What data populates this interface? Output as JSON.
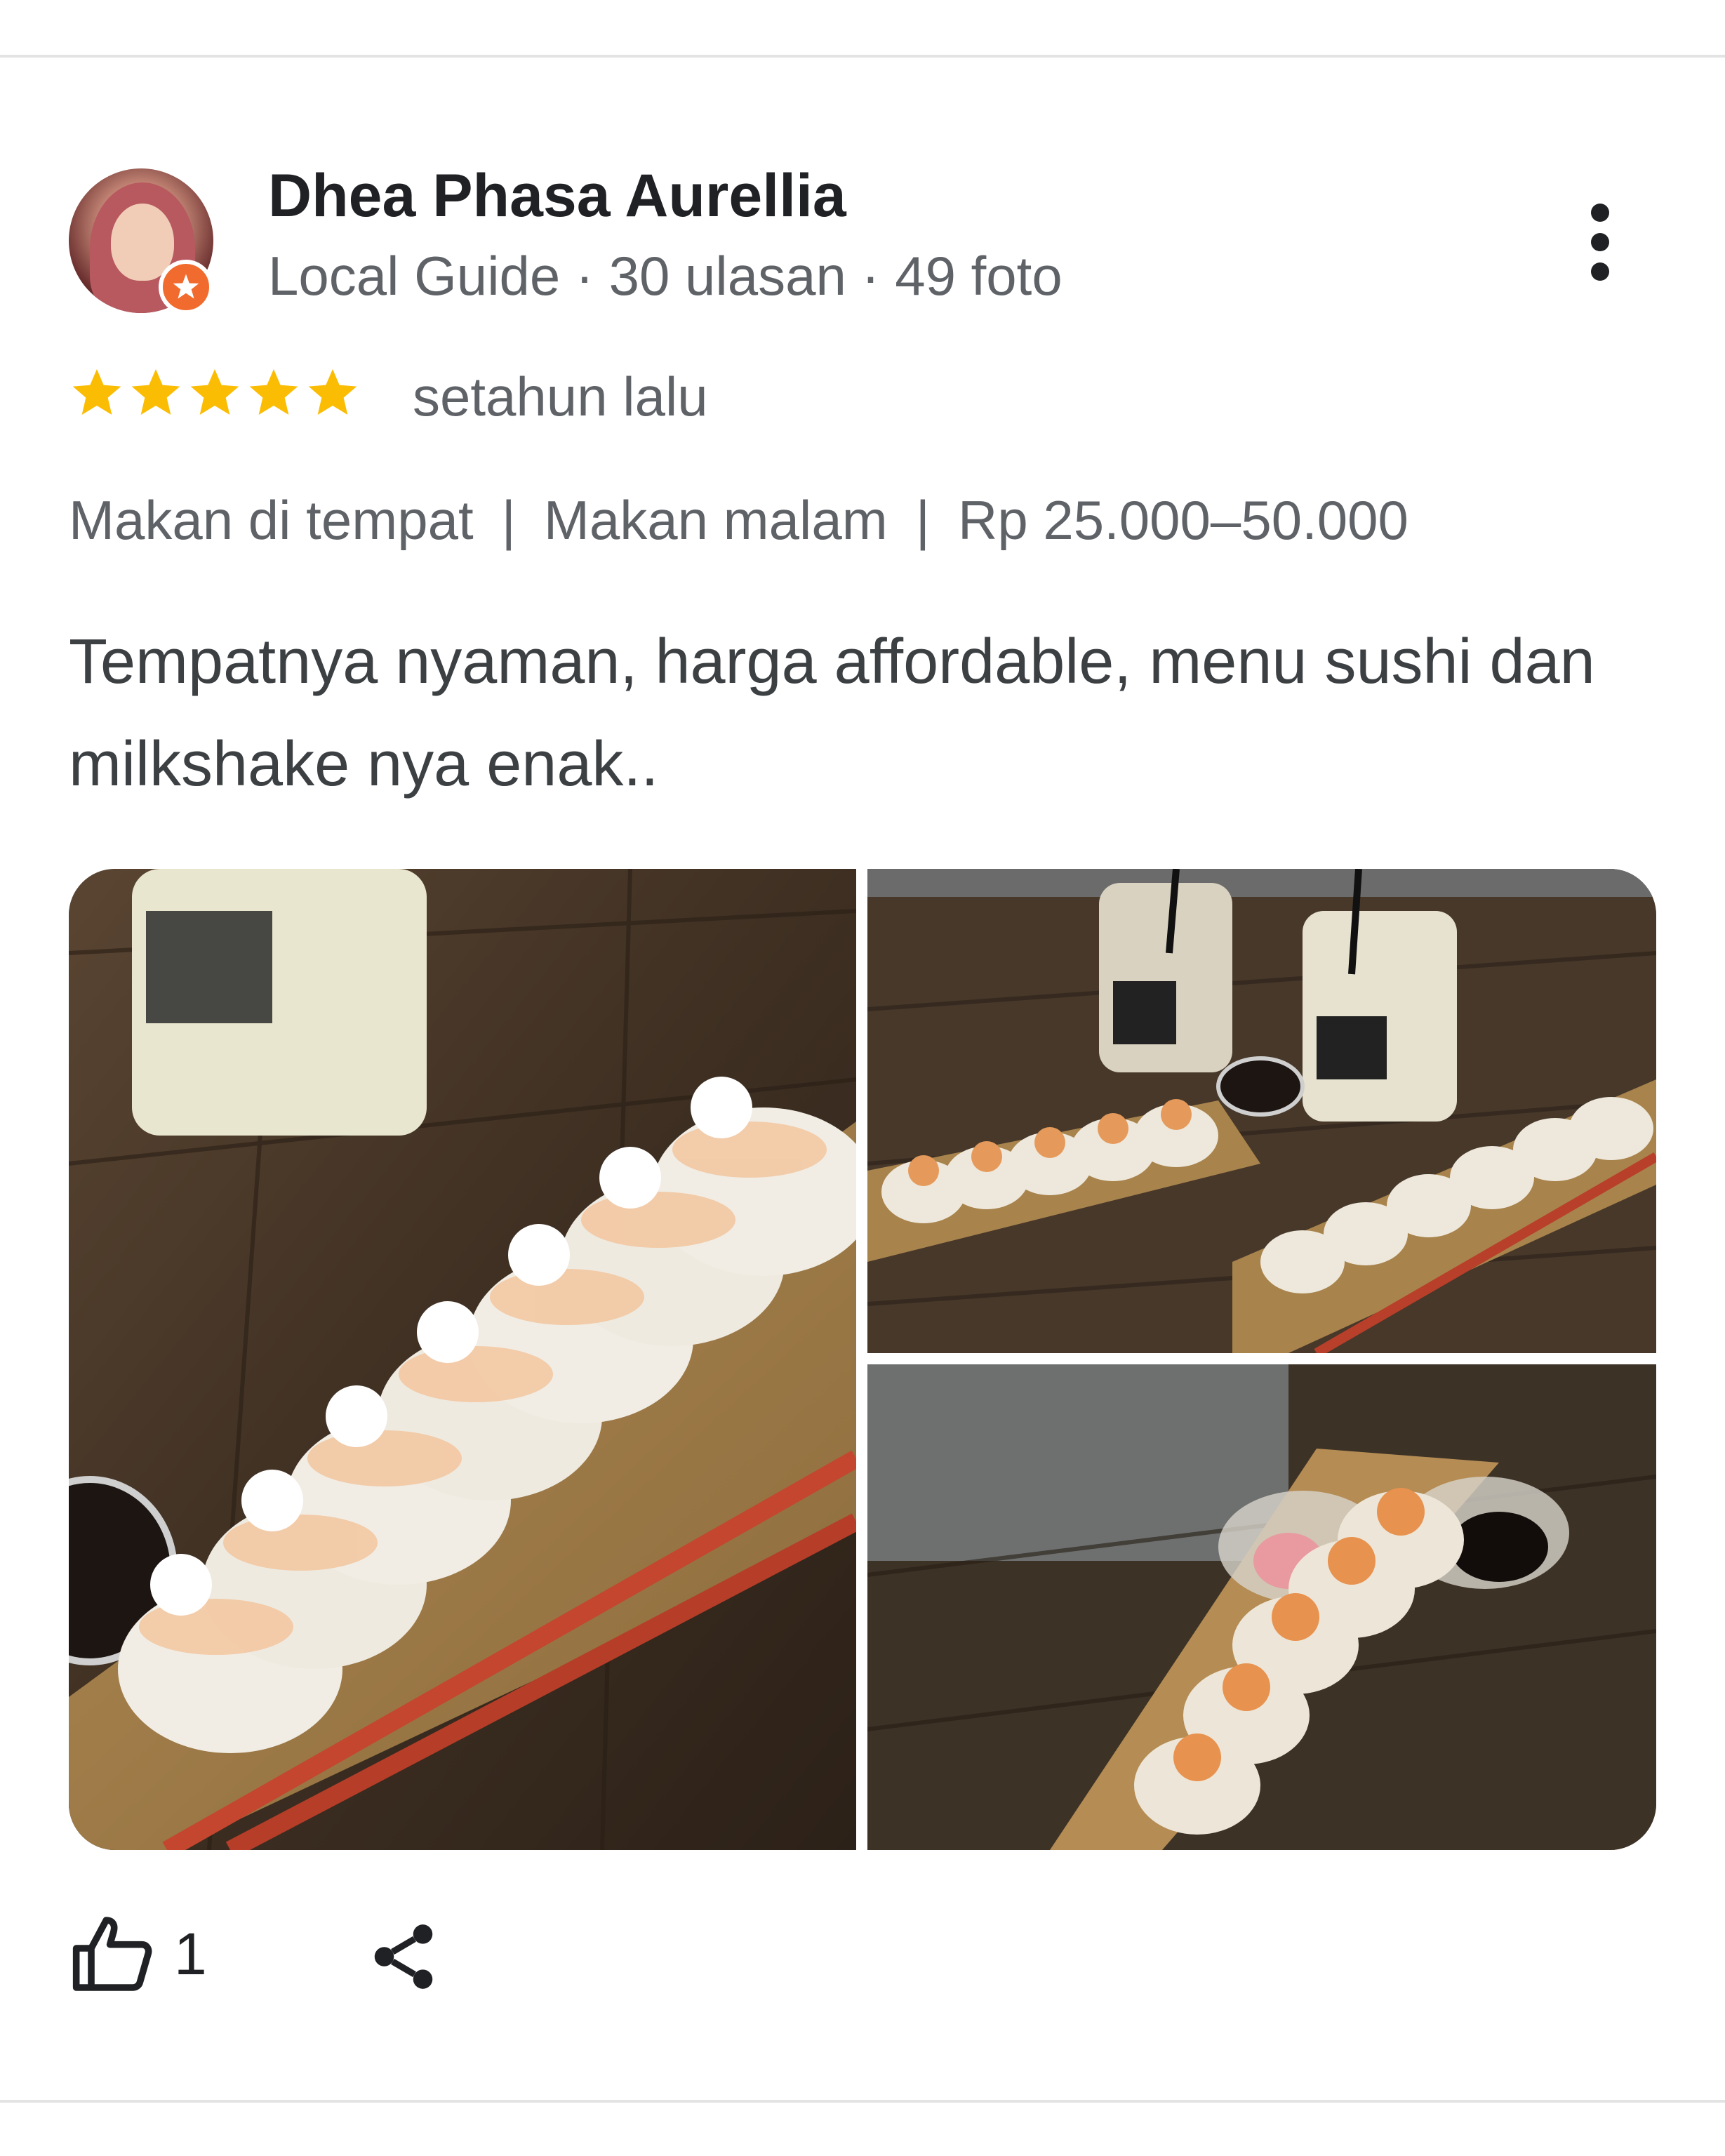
{
  "reviewer": {
    "name": "Dhea Phasa Aurellia",
    "meta": "Local Guide · 30 ulasan · 49 foto",
    "avatar_icon": "profile-avatar",
    "badge_icon": "local-guide-star-badge",
    "badge_color": "#f26b2e"
  },
  "rating": {
    "stars": 5,
    "max_stars": 5,
    "star_color": "#fbbc04",
    "time_ago": "setahun lalu"
  },
  "attributes": {
    "items": [
      "Makan di tempat",
      "Makan malam",
      "Rp 25.000–50.000"
    ],
    "separator": "|"
  },
  "review": {
    "text": "Tempatnya nyaman, harga affordable, menu sushi dan milkshake nya enak.."
  },
  "photos": [
    {
      "subject": "sushi-roll-closeup",
      "icon": "photo"
    },
    {
      "subject": "sushi-and-drinks",
      "icon": "photo"
    },
    {
      "subject": "sushi-plate",
      "icon": "photo"
    }
  ],
  "actions": {
    "like_icon": "thumbs-up-icon",
    "like_count": "1",
    "share_icon": "share-icon"
  },
  "menu": {
    "icon": "more-vert-icon"
  }
}
